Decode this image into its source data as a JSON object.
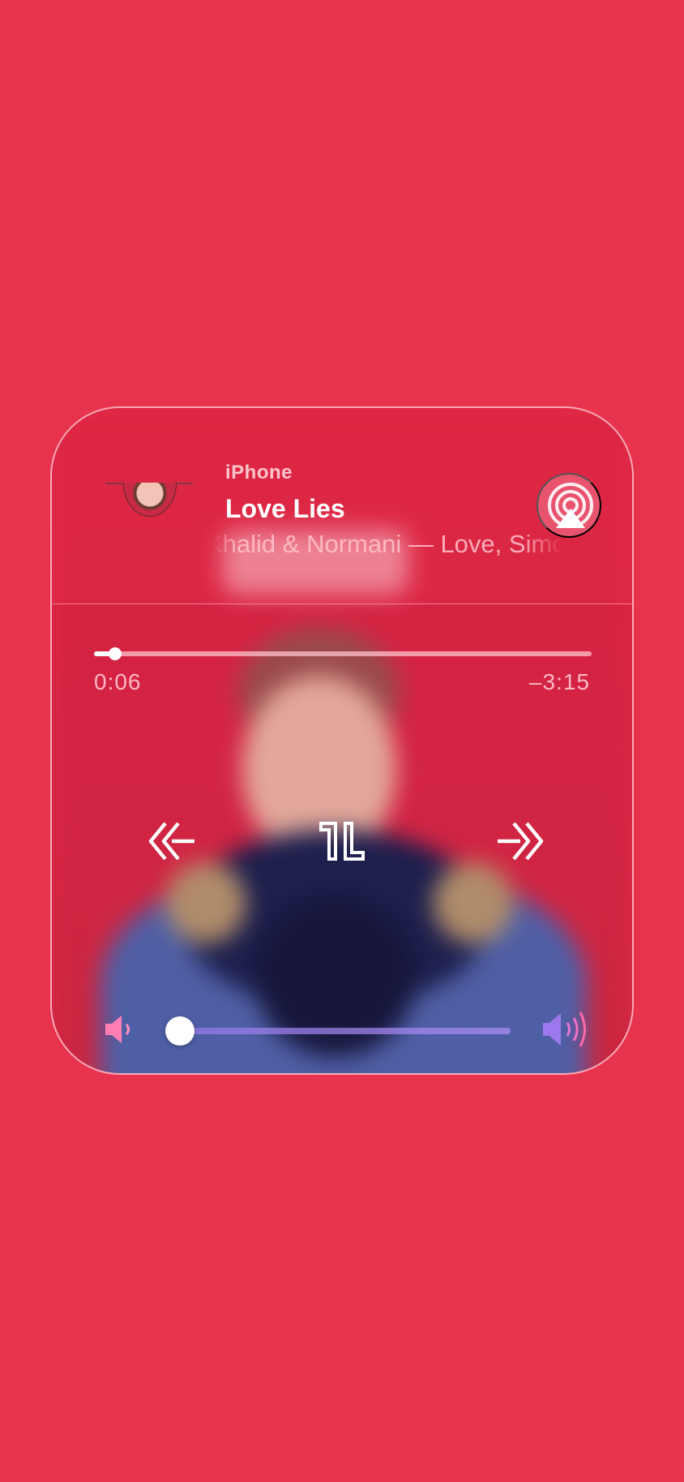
{
  "now_playing": {
    "source_label": "iPhone",
    "track_title": "Love Lies",
    "artist_line": "Khalid & Normani — Love, Simon",
    "airplay_icon": "airplay-icon"
  },
  "playback": {
    "elapsed": "0:06",
    "remaining": "–3:15",
    "progress_fraction": 0.03
  },
  "controls": {
    "rewind_icon": "rewind-icon",
    "pause_icon": "pause-icon",
    "fast_forward_icon": "fast-forward-icon"
  },
  "volume": {
    "level_fraction": 0.0,
    "min_icon": "volume-low-icon",
    "max_icon": "volume-high-icon"
  },
  "colors": {
    "background": "#e8334f",
    "card": "#de2b47",
    "volume_track": "#9a7ee6"
  }
}
